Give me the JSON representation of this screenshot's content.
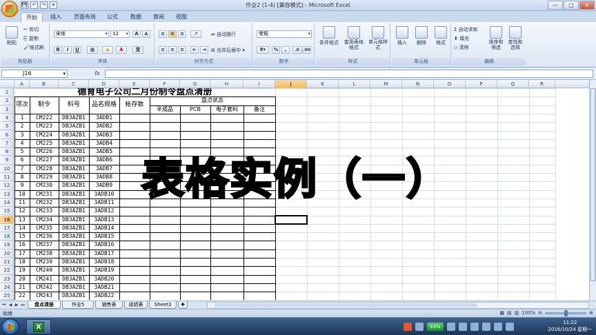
{
  "window": {
    "title": "作业2 (1-4) [兼容模式] - Microsoft Excel",
    "controls": [
      "—",
      "□",
      "×"
    ]
  },
  "quick_access": [
    "💾",
    "↶",
    "↷",
    "▾"
  ],
  "ribbon_tabs": [
    "开始",
    "插入",
    "页面布局",
    "公式",
    "数据",
    "审阅",
    "视图"
  ],
  "ribbon": {
    "clipboard": {
      "paste": "粘贴",
      "cut": "剪切",
      "copy": "复制",
      "format_painter": "格式刷",
      "label": "剪贴板"
    },
    "font": {
      "name": "宋体",
      "size": "12",
      "grow": "A",
      "shrink": "A",
      "bold": "B",
      "italic": "I",
      "underline": "U",
      "wen": "变",
      "label": "字体"
    },
    "alignment": {
      "wrap": "自动换行",
      "merge": "合并后居中",
      "label": "对齐方式"
    },
    "number": {
      "format": "常规",
      "percent": "%",
      "comma": ",",
      "label": "数字"
    },
    "styles": {
      "conditional": "条件格式",
      "as_table": "套用表格格式",
      "cell_styles": "单元格样式",
      "label": "样式"
    },
    "cells": {
      "insert": "插入",
      "delete": "删除",
      "format": "格式",
      "label": "单元格"
    },
    "editing": {
      "autosum": "Σ 自动求和",
      "fill": "填充",
      "clear": "清除",
      "sort": "排序和筛选",
      "find": "查找和选择",
      "label": "编辑"
    }
  },
  "formula_bar": {
    "name_box": "J16",
    "fx": "fx",
    "value": ""
  },
  "columns": [
    "A",
    "B",
    "C",
    "D",
    "E",
    "F",
    "G",
    "H",
    "I",
    "J",
    "K",
    "L",
    "M",
    "N",
    "O",
    "P",
    "Q",
    "R"
  ],
  "selected_column": "J",
  "selected_row": "16",
  "rows": [
    "1",
    "2",
    "3",
    "4",
    "5",
    "6",
    "7",
    "8",
    "9",
    "10",
    "11",
    "12",
    "13",
    "14",
    "15",
    "16",
    "17",
    "18",
    "19",
    "20",
    "21",
    "22",
    "23",
    "24",
    "25"
  ],
  "table": {
    "title": "德育电子公司二月份制令盘点清册",
    "headers": {
      "a": "项次",
      "b": "制令",
      "c": "料号",
      "d": "品名规格",
      "e": "帐存数",
      "status": "盘点状态",
      "f": "半成品",
      "g": "PCB",
      "h": "电子套料",
      "i": "备注"
    },
    "data": [
      [
        "1",
        "CM222",
        "DB3AZB1",
        "3ADB1"
      ],
      [
        "2",
        "CM223",
        "DB3AZB1",
        "3ADB2"
      ],
      [
        "3",
        "CM224",
        "DB3AZB1",
        "3ADB3"
      ],
      [
        "4",
        "CM225",
        "DB3AZB1",
        "3ADB4"
      ],
      [
        "5",
        "CM226",
        "DB3AZB1",
        "3ADB5"
      ],
      [
        "6",
        "CM227",
        "DB3AZB1",
        "3ADB6"
      ],
      [
        "7",
        "CM228",
        "DB3AZB1",
        "3ADB7"
      ],
      [
        "8",
        "CM229",
        "DB3AZB1",
        "3ADB8"
      ],
      [
        "9",
        "CM230",
        "DB3AZB1",
        "3ADB9"
      ],
      [
        "10",
        "CM231",
        "DB3AZB1",
        "3ADB10"
      ],
      [
        "11",
        "CM232",
        "DB3AZB1",
        "3ADB11"
      ],
      [
        "12",
        "CM233",
        "DB3AZB1",
        "3ADB12"
      ],
      [
        "13",
        "CM234",
        "DB3AZB1",
        "3ADB13"
      ],
      [
        "14",
        "CM235",
        "DB3AZB1",
        "3ADB14"
      ],
      [
        "15",
        "CM236",
        "DB3AZB1",
        "3ADB15"
      ],
      [
        "16",
        "CM237",
        "DB3AZB1",
        "3ADB16"
      ],
      [
        "17",
        "CM238",
        "DB3AZB1",
        "3ADB17"
      ],
      [
        "18",
        "CM239",
        "DB3AZB1",
        "3ADB18"
      ],
      [
        "19",
        "CM240",
        "DB3AZB1",
        "3ADB19"
      ],
      [
        "20",
        "CM241",
        "DB3AZB1",
        "3ADB20"
      ],
      [
        "21",
        "CM242",
        "DB3AZB1",
        "3ADB21"
      ],
      [
        "22",
        "CM243",
        "DB3AZB1",
        "3ADB22"
      ]
    ]
  },
  "overlay_text": "表格实例（一）",
  "sheet_tabs": [
    "盘点清册",
    "作业5",
    "销售表",
    "成绩表",
    "Sheet3"
  ],
  "active_sheet": "盘点清册",
  "status": {
    "ready": "就绪",
    "zoom": "100%"
  },
  "taskbar": {
    "battery": "93%",
    "time": "11:22",
    "date": "2016/10/24 星期一"
  }
}
